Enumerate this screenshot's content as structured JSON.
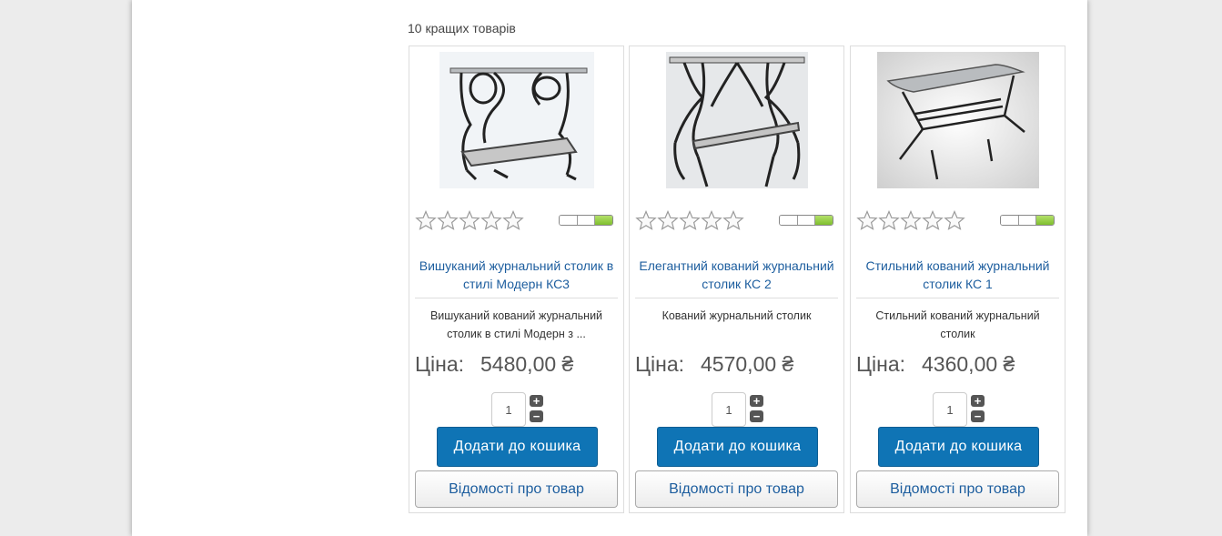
{
  "module": {
    "title": "10 кращих товарів"
  },
  "products": [
    {
      "name": "Вишуканий журнальний столик в стилі Модерн КС3",
      "description": "Вишуканий кований журнальний столик в стилі Модерн з ...",
      "price_label": "Ціна:",
      "price": "5480,00 ₴",
      "quantity": "1",
      "rating": 0,
      "add_to_cart": "Додати до кошика",
      "details": "Відомості про товар",
      "image_icon": "ornate-wrought-iron-table-photo"
    },
    {
      "name": "Елегантний кований журнальний столик КС 2",
      "description": "Кований журнальний столик",
      "price_label": "Ціна:",
      "price": "4570,00 ₴",
      "quantity": "1",
      "rating": 0,
      "add_to_cart": "Додати до кошика",
      "details": "Відомості про товар",
      "image_icon": "curved-wrought-iron-table-photo"
    },
    {
      "name": "Стильний кований журнальний столик КС 1",
      "description": "Стильний кований журнальний столик",
      "price_label": "Ціна:",
      "price": "4360,00 ₴",
      "quantity": "1",
      "rating": 0,
      "add_to_cart": "Додати до кошика",
      "details": "Відомості про товар",
      "image_icon": "modern-wrought-iron-table-photo"
    }
  ],
  "colors": {
    "link": "#1c5d9e",
    "button": "#0f74b5",
    "availability": "#7fbf2e"
  }
}
